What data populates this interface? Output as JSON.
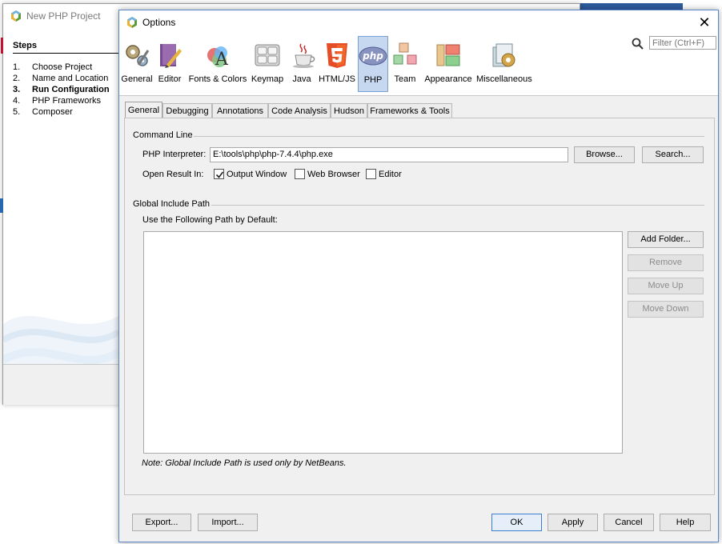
{
  "wizard": {
    "title": "New PHP Project",
    "steps_header": "Steps",
    "steps": [
      {
        "num": "1.",
        "label": "Choose Project"
      },
      {
        "num": "2.",
        "label": "Name and Location"
      },
      {
        "num": "3.",
        "label": "Run Configuration"
      },
      {
        "num": "4.",
        "label": "PHP Frameworks"
      },
      {
        "num": "5.",
        "label": "Composer"
      }
    ],
    "current_step": 3
  },
  "dialog": {
    "title": "Options",
    "close_glyph": "✕",
    "filter_placeholder": "Filter (Ctrl+F)",
    "categories": [
      {
        "label": "General",
        "icon": "gears-icon"
      },
      {
        "label": "Editor",
        "icon": "editor-book-icon"
      },
      {
        "label": "Fonts & Colors",
        "icon": "fonts-colors-icon"
      },
      {
        "label": "Keymap",
        "icon": "keymap-icon"
      },
      {
        "label": "Java",
        "icon": "java-cup-icon"
      },
      {
        "label": "HTML/JS",
        "icon": "html5-icon"
      },
      {
        "label": "PHP",
        "icon": "php-icon",
        "selected": true
      },
      {
        "label": "Team",
        "icon": "team-cubes-icon"
      },
      {
        "label": "Appearance",
        "icon": "appearance-icon"
      },
      {
        "label": "Miscellaneous",
        "icon": "misc-icon"
      }
    ],
    "tabs": [
      "General",
      "Debugging",
      "Annotations",
      "Code Analysis",
      "Hudson",
      "Frameworks & Tools"
    ],
    "selected_tab": "General",
    "command_line": {
      "section_title": "Command Line",
      "interpreter_label": "PHP Interpreter:",
      "interpreter_value": "E:\\tools\\php\\php-7.4.4\\php.exe",
      "browse_button": "Browse...",
      "search_button": "Search...",
      "open_result_label": "Open Result In:",
      "options": [
        {
          "label": "Output Window",
          "checked": true
        },
        {
          "label": "Web Browser",
          "checked": false
        },
        {
          "label": "Editor",
          "checked": false
        }
      ]
    },
    "include_path": {
      "section_title": "Global Include Path",
      "use_default_label": "Use the Following Path by Default:",
      "add_folder_button": "Add Folder...",
      "remove_button": "Remove",
      "move_up_button": "Move Up",
      "move_down_button": "Move Down",
      "note": "Note: Global Include Path is used only by NetBeans."
    },
    "footer": {
      "export_button": "Export...",
      "import_button": "Import...",
      "ok_button": "OK",
      "apply_button": "Apply",
      "cancel_button": "Cancel",
      "help_button": "Help"
    }
  }
}
